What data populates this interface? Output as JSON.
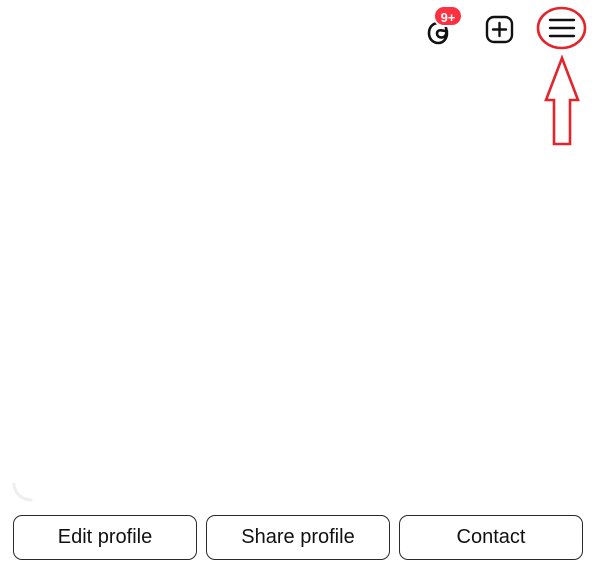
{
  "header": {
    "threads_icon": "threads-icon",
    "threads_badge": "9+",
    "create_icon": "plus-square-icon",
    "menu_icon": "hamburger-menu-icon"
  },
  "annotation": {
    "circle_color": "#e3242b",
    "arrow_color": "#e3242b"
  },
  "actions": {
    "edit_profile": "Edit profile",
    "share_profile": "Share profile",
    "contact": "Contact"
  },
  "colors": {
    "badge": "#ff3040",
    "button_border": "#2a2a2a",
    "text": "#111111",
    "background": "#ffffff"
  }
}
